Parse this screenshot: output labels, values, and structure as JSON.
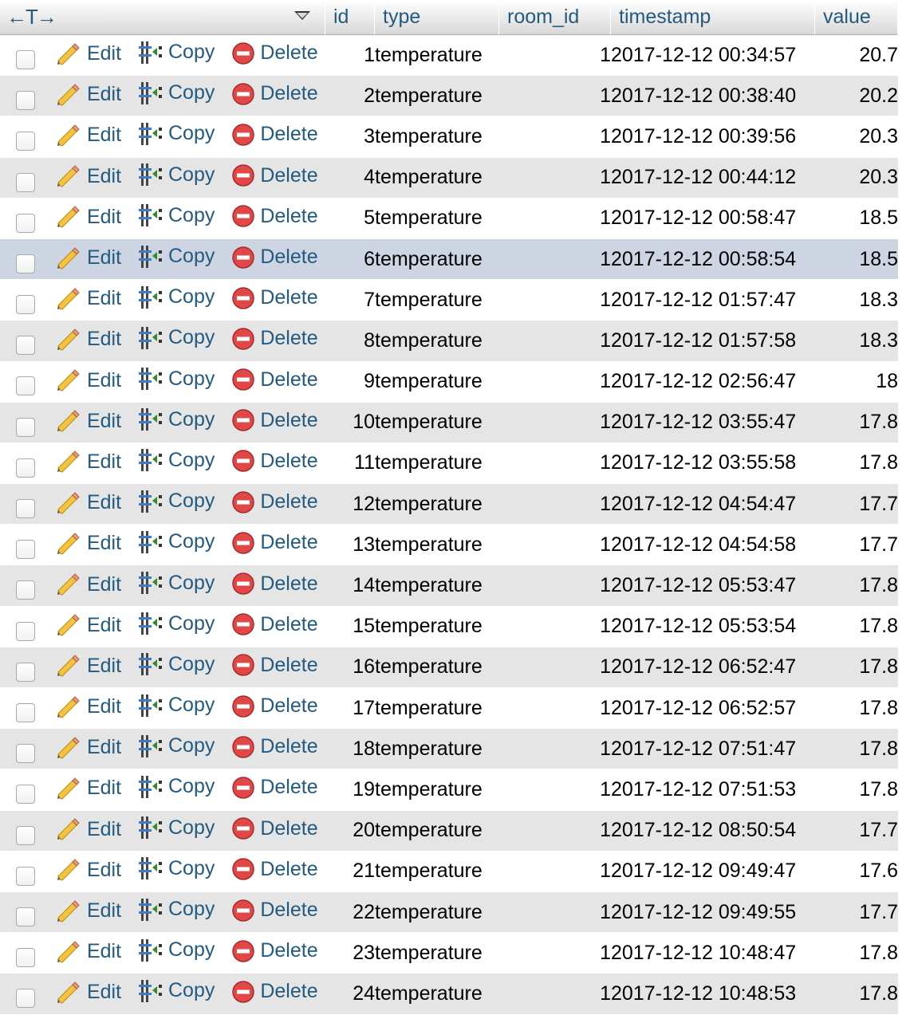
{
  "header": {
    "nav_label": "←T→",
    "columns": [
      "id",
      "type",
      "room_id",
      "timestamp",
      "value"
    ]
  },
  "actions": {
    "edit": "Edit",
    "copy": "Copy",
    "delete": "Delete"
  },
  "highlighted_row_id": "6",
  "rows": [
    {
      "id": "1",
      "type": "temperature",
      "room_id": "1",
      "timestamp": "2017-12-12 00:34:57",
      "value": "20.7"
    },
    {
      "id": "2",
      "type": "temperature",
      "room_id": "1",
      "timestamp": "2017-12-12 00:38:40",
      "value": "20.2"
    },
    {
      "id": "3",
      "type": "temperature",
      "room_id": "1",
      "timestamp": "2017-12-12 00:39:56",
      "value": "20.3"
    },
    {
      "id": "4",
      "type": "temperature",
      "room_id": "1",
      "timestamp": "2017-12-12 00:44:12",
      "value": "20.3"
    },
    {
      "id": "5",
      "type": "temperature",
      "room_id": "1",
      "timestamp": "2017-12-12 00:58:47",
      "value": "18.5"
    },
    {
      "id": "6",
      "type": "temperature",
      "room_id": "1",
      "timestamp": "2017-12-12 00:58:54",
      "value": "18.5"
    },
    {
      "id": "7",
      "type": "temperature",
      "room_id": "1",
      "timestamp": "2017-12-12 01:57:47",
      "value": "18.3"
    },
    {
      "id": "8",
      "type": "temperature",
      "room_id": "1",
      "timestamp": "2017-12-12 01:57:58",
      "value": "18.3"
    },
    {
      "id": "9",
      "type": "temperature",
      "room_id": "1",
      "timestamp": "2017-12-12 02:56:47",
      "value": "18"
    },
    {
      "id": "10",
      "type": "temperature",
      "room_id": "1",
      "timestamp": "2017-12-12 03:55:47",
      "value": "17.8"
    },
    {
      "id": "11",
      "type": "temperature",
      "room_id": "1",
      "timestamp": "2017-12-12 03:55:58",
      "value": "17.8"
    },
    {
      "id": "12",
      "type": "temperature",
      "room_id": "1",
      "timestamp": "2017-12-12 04:54:47",
      "value": "17.7"
    },
    {
      "id": "13",
      "type": "temperature",
      "room_id": "1",
      "timestamp": "2017-12-12 04:54:58",
      "value": "17.7"
    },
    {
      "id": "14",
      "type": "temperature",
      "room_id": "1",
      "timestamp": "2017-12-12 05:53:47",
      "value": "17.8"
    },
    {
      "id": "15",
      "type": "temperature",
      "room_id": "1",
      "timestamp": "2017-12-12 05:53:54",
      "value": "17.8"
    },
    {
      "id": "16",
      "type": "temperature",
      "room_id": "1",
      "timestamp": "2017-12-12 06:52:47",
      "value": "17.8"
    },
    {
      "id": "17",
      "type": "temperature",
      "room_id": "1",
      "timestamp": "2017-12-12 06:52:57",
      "value": "17.8"
    },
    {
      "id": "18",
      "type": "temperature",
      "room_id": "1",
      "timestamp": "2017-12-12 07:51:47",
      "value": "17.8"
    },
    {
      "id": "19",
      "type": "temperature",
      "room_id": "1",
      "timestamp": "2017-12-12 07:51:53",
      "value": "17.8"
    },
    {
      "id": "20",
      "type": "temperature",
      "room_id": "1",
      "timestamp": "2017-12-12 08:50:54",
      "value": "17.7"
    },
    {
      "id": "21",
      "type": "temperature",
      "room_id": "1",
      "timestamp": "2017-12-12 09:49:47",
      "value": "17.6"
    },
    {
      "id": "22",
      "type": "temperature",
      "room_id": "1",
      "timestamp": "2017-12-12 09:49:55",
      "value": "17.7"
    },
    {
      "id": "23",
      "type": "temperature",
      "room_id": "1",
      "timestamp": "2017-12-12 10:48:47",
      "value": "17.8"
    },
    {
      "id": "24",
      "type": "temperature",
      "room_id": "1",
      "timestamp": "2017-12-12 10:48:53",
      "value": "17.8"
    }
  ]
}
